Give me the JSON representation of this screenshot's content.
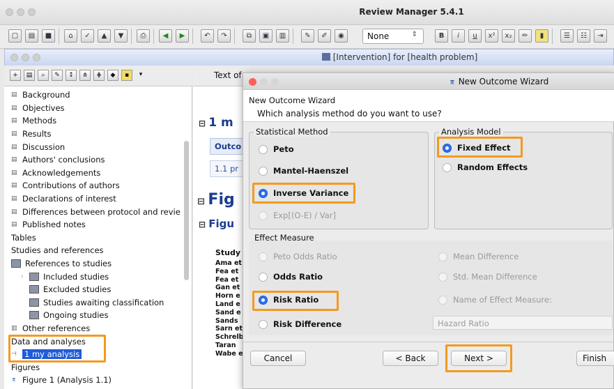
{
  "app": {
    "title": "Review Manager 5.4.1"
  },
  "toolbar": {
    "style_value": "None"
  },
  "document": {
    "title": "[Intervention] for [health problem]"
  },
  "tree": {
    "items": [
      "Background",
      "Objectives",
      "Methods",
      "Results",
      "Discussion",
      "Authors' conclusions",
      "Acknowledgements",
      "Contributions of authors",
      "Declarations of interest",
      "Differences between protocol and revie",
      "Published notes",
      "Tables",
      "Studies and references",
      "References to studies",
      "Included studies",
      "Excluded studies",
      "Studies awaiting classification",
      "Ongoing studies",
      "Other references",
      "Data and analyses",
      "1 my analysis",
      "Figures",
      "Figure 1 (Analysis 1.1)"
    ]
  },
  "middle": {
    "tab": "Text of",
    "heading1": "1 m",
    "outcome_label": "Outco",
    "sub_label": "1.1 pr",
    "fig_big": "Fig",
    "fig_small": "Figu",
    "study_header": "Study",
    "studies": [
      "Ama et",
      "Fea et",
      "Fea et",
      "Gan et",
      "Horn e",
      "Land e",
      "Sand e",
      "Sands",
      "Sarn et",
      "Schrelb",
      "Taran",
      "Wabe e"
    ]
  },
  "wizard": {
    "title": "New Outcome Wizard",
    "header_title": "New Outcome Wizard",
    "question": "Which analysis method do you want to use?",
    "statistical_method": {
      "legend": "Statistical Method",
      "options": [
        "Peto",
        "Mantel-Haenszel",
        "Inverse Variance",
        "Exp[(O-E) / Var]"
      ],
      "selected": "Inverse Variance"
    },
    "analysis_model": {
      "legend": "Analysis Model",
      "options": [
        "Fixed Effect",
        "Random Effects"
      ],
      "selected": "Fixed Effect"
    },
    "effect_measure": {
      "legend": "Effect Measure",
      "left_options": [
        "Peto Odds Ratio",
        "Odds Ratio",
        "Risk Ratio",
        "Risk Difference"
      ],
      "right_options": [
        "Mean Difference",
        "Std. Mean Difference",
        "Name of Effect Measure:"
      ],
      "custom_value": "Hazard Ratio",
      "selected": "Risk Ratio"
    },
    "buttons": {
      "cancel": "Cancel",
      "back": "< Back",
      "next": "Next >",
      "finish": "Finish"
    }
  },
  "colors": {
    "highlight": "#f39a1e",
    "selection": "#1f5cd6",
    "radio_selected": "#2d6ef2"
  }
}
